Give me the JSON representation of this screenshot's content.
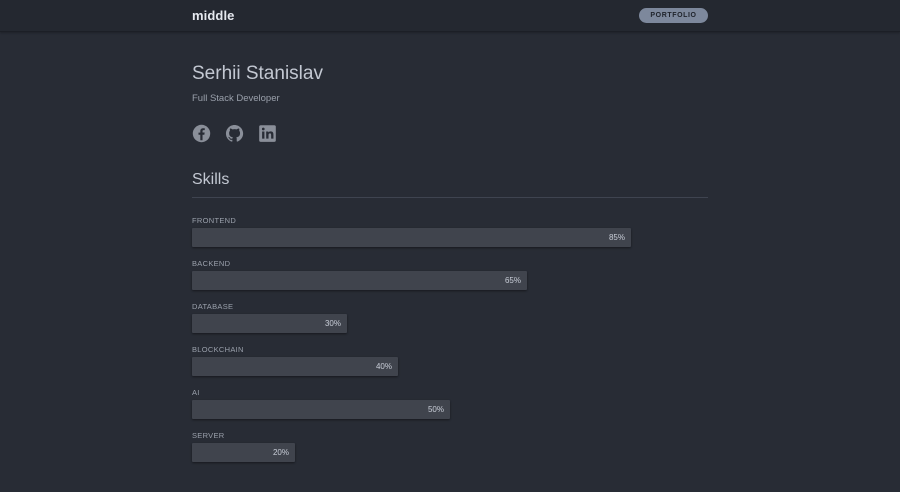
{
  "header": {
    "brand": "middle",
    "portfolio_label": "PORTFOLIO"
  },
  "profile": {
    "name": "Serhii Stanislav",
    "role": "Full Stack Developer"
  },
  "socials": [
    {
      "icon": "facebook-icon"
    },
    {
      "icon": "github-icon"
    },
    {
      "icon": "linkedin-icon"
    }
  ],
  "skills": {
    "title": "Skills",
    "items": [
      {
        "label": "FRONTEND",
        "percent": 85,
        "percent_label": "85%"
      },
      {
        "label": "BACKEND",
        "percent": 65,
        "percent_label": "65%"
      },
      {
        "label": "DATABASE",
        "percent": 30,
        "percent_label": "30%"
      },
      {
        "label": "BLOCKCHAIN",
        "percent": 40,
        "percent_label": "40%"
      },
      {
        "label": "AI",
        "percent": 50,
        "percent_label": "50%"
      },
      {
        "label": "SERVER",
        "percent": 20,
        "percent_label": "20%"
      }
    ]
  },
  "colors": {
    "background": "#282c35",
    "header": "#242830",
    "bar": "#40444d",
    "button": "#7d889c",
    "icon": "#8a8f99"
  }
}
